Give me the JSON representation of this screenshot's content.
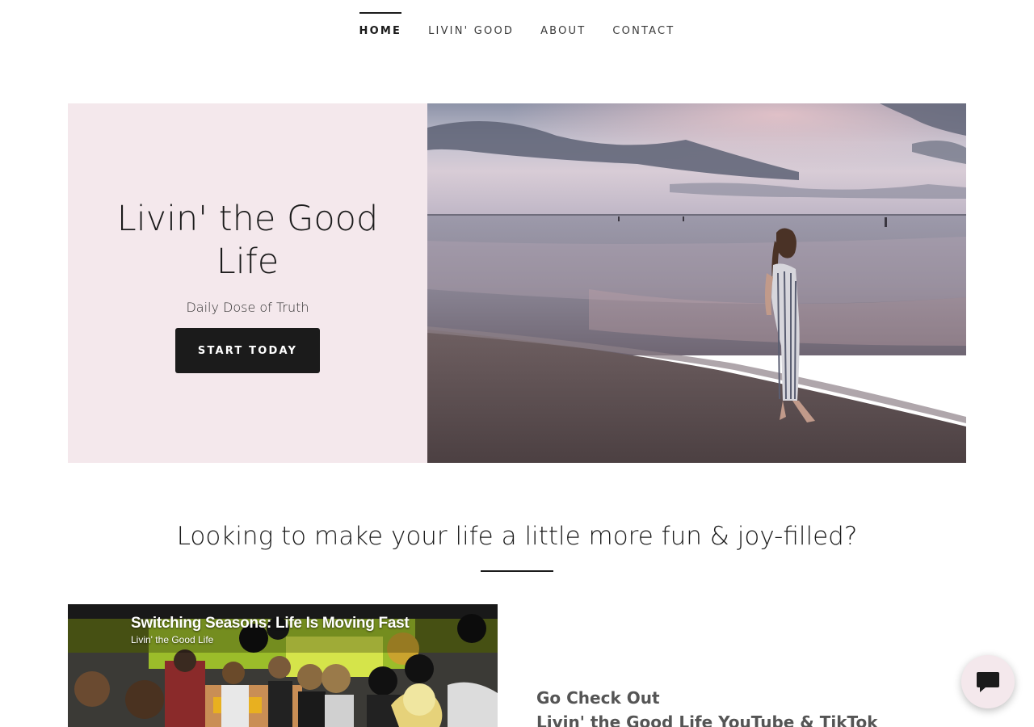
{
  "nav": {
    "items": [
      {
        "label": "HOME",
        "active": true
      },
      {
        "label": "LIVIN' GOOD",
        "active": false
      },
      {
        "label": "ABOUT",
        "active": false
      },
      {
        "label": "CONTACT",
        "active": false
      }
    ]
  },
  "hero": {
    "title": "Livin' the Good Life",
    "subtitle": "Daily Dose of Truth",
    "button_label": "START TODAY",
    "panel_color": "#f4e8ec",
    "image_icon": "beach-sunset-photo"
  },
  "section": {
    "title": "Looking to make your life a little more fun & joy-filled?"
  },
  "video": {
    "title": "Switching Seasons: Life Is Moving Fast",
    "channel": "Livin' the Good Life"
  },
  "checkout": {
    "line1": "Go Check Out",
    "line2": "Livin' the Good Life YouTube & TikTok"
  },
  "chat": {
    "icon": "chat-bubble-icon"
  }
}
